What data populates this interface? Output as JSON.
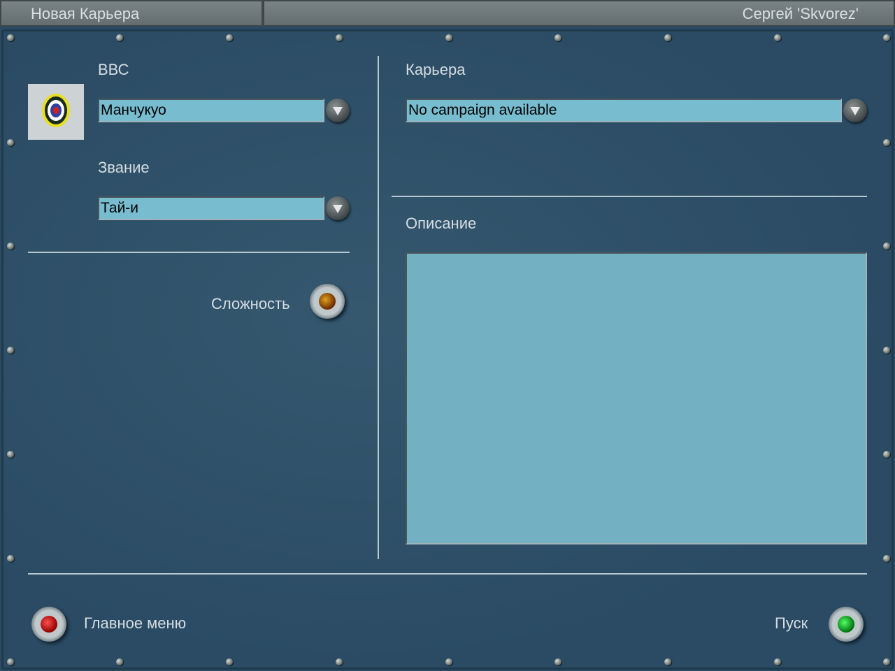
{
  "header": {
    "title": "Новая Карьера",
    "user": "Сергей 'Skvorez'"
  },
  "left": {
    "air_force_label": "ВВС",
    "air_force_value": "Манчукуо",
    "rank_label": "Звание",
    "rank_value": "Тай-и",
    "difficulty_label": "Сложность"
  },
  "right": {
    "career_label": "Карьера",
    "career_value": "No campaign available",
    "description_label": "Описание",
    "description_text": ""
  },
  "footer": {
    "main_menu_label": "Главное меню",
    "start_label": "Пуск"
  },
  "colors": {
    "field": "#78bcd0",
    "panel": "#2a4a63",
    "lamp_red": "#d01010",
    "lamp_green": "#10b020",
    "lamp_amber": "#7a3a00"
  }
}
